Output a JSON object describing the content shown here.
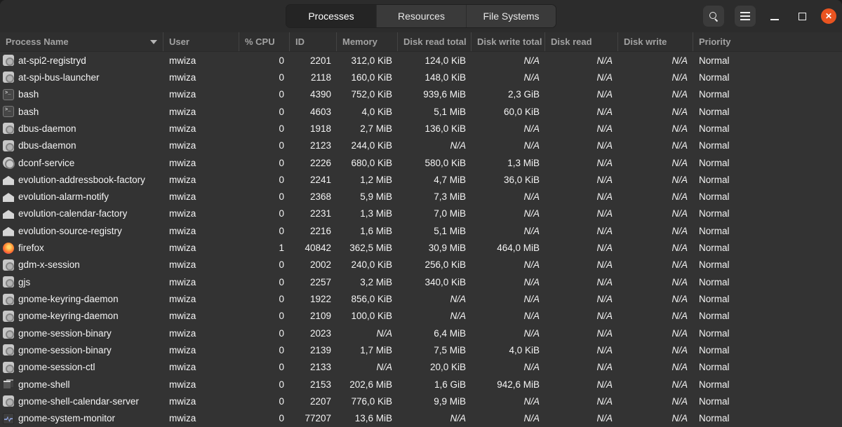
{
  "header": {
    "tabs": [
      {
        "label": "Processes",
        "active": true
      },
      {
        "label": "Resources",
        "active": false
      },
      {
        "label": "File Systems",
        "active": false
      }
    ],
    "close_label": "✕"
  },
  "colors": {
    "close_button": "#e95420",
    "headerbar": "#2c2c2c",
    "table_background": "#333333"
  },
  "table": {
    "columns": [
      {
        "key": "name",
        "label": "Process Name",
        "sorted": "desc"
      },
      {
        "key": "user",
        "label": "User"
      },
      {
        "key": "cpu",
        "label": "% CPU"
      },
      {
        "key": "id",
        "label": "ID"
      },
      {
        "key": "memory",
        "label": "Memory"
      },
      {
        "key": "disk_read_total",
        "label": "Disk read total"
      },
      {
        "key": "disk_write_total",
        "label": "Disk write total"
      },
      {
        "key": "disk_read",
        "label": "Disk read"
      },
      {
        "key": "disk_write",
        "label": "Disk write"
      },
      {
        "key": "priority",
        "label": "Priority"
      }
    ],
    "rows": [
      {
        "name": "at-spi2-registryd",
        "icon": "application",
        "user": "mwiza",
        "cpu": "0",
        "id": "2201",
        "memory": "312,0 KiB",
        "disk_read_total": "124,0 KiB",
        "disk_write_total": "N/A",
        "disk_read": "N/A",
        "disk_write": "N/A",
        "priority": "Normal"
      },
      {
        "name": "at-spi-bus-launcher",
        "icon": "application",
        "user": "mwiza",
        "cpu": "0",
        "id": "2118",
        "memory": "160,0 KiB",
        "disk_read_total": "148,0 KiB",
        "disk_write_total": "N/A",
        "disk_read": "N/A",
        "disk_write": "N/A",
        "priority": "Normal"
      },
      {
        "name": "bash",
        "icon": "terminal",
        "user": "mwiza",
        "cpu": "0",
        "id": "4390",
        "memory": "752,0 KiB",
        "disk_read_total": "939,6 MiB",
        "disk_write_total": "2,3 GiB",
        "disk_read": "N/A",
        "disk_write": "N/A",
        "priority": "Normal"
      },
      {
        "name": "bash",
        "icon": "terminal",
        "user": "mwiza",
        "cpu": "0",
        "id": "4603",
        "memory": "4,0 KiB",
        "disk_read_total": "5,1 MiB",
        "disk_write_total": "60,0 KiB",
        "disk_read": "N/A",
        "disk_write": "N/A",
        "priority": "Normal"
      },
      {
        "name": "dbus-daemon",
        "icon": "application",
        "user": "mwiza",
        "cpu": "0",
        "id": "1918",
        "memory": "2,7 MiB",
        "disk_read_total": "136,0 KiB",
        "disk_write_total": "N/A",
        "disk_read": "N/A",
        "disk_write": "N/A",
        "priority": "Normal"
      },
      {
        "name": "dbus-daemon",
        "icon": "application",
        "user": "mwiza",
        "cpu": "0",
        "id": "2123",
        "memory": "244,0 KiB",
        "disk_read_total": "N/A",
        "disk_write_total": "N/A",
        "disk_read": "N/A",
        "disk_write": "N/A",
        "priority": "Normal"
      },
      {
        "name": "dconf-service",
        "icon": "rings",
        "user": "mwiza",
        "cpu": "0",
        "id": "2226",
        "memory": "680,0 KiB",
        "disk_read_total": "580,0 KiB",
        "disk_write_total": "1,3 MiB",
        "disk_read": "N/A",
        "disk_write": "N/A",
        "priority": "Normal"
      },
      {
        "name": "evolution-addressbook-factory",
        "icon": "envelope",
        "user": "mwiza",
        "cpu": "0",
        "id": "2241",
        "memory": "1,2 MiB",
        "disk_read_total": "4,7 MiB",
        "disk_write_total": "36,0 KiB",
        "disk_read": "N/A",
        "disk_write": "N/A",
        "priority": "Normal"
      },
      {
        "name": "evolution-alarm-notify",
        "icon": "envelope",
        "user": "mwiza",
        "cpu": "0",
        "id": "2368",
        "memory": "5,9 MiB",
        "disk_read_total": "7,3 MiB",
        "disk_write_total": "N/A",
        "disk_read": "N/A",
        "disk_write": "N/A",
        "priority": "Normal"
      },
      {
        "name": "evolution-calendar-factory",
        "icon": "envelope",
        "user": "mwiza",
        "cpu": "0",
        "id": "2231",
        "memory": "1,3 MiB",
        "disk_read_total": "7,0 MiB",
        "disk_write_total": "N/A",
        "disk_read": "N/A",
        "disk_write": "N/A",
        "priority": "Normal"
      },
      {
        "name": "evolution-source-registry",
        "icon": "envelope",
        "user": "mwiza",
        "cpu": "0",
        "id": "2216",
        "memory": "1,6 MiB",
        "disk_read_total": "5,1 MiB",
        "disk_write_total": "N/A",
        "disk_read": "N/A",
        "disk_write": "N/A",
        "priority": "Normal"
      },
      {
        "name": "firefox",
        "icon": "firefox",
        "user": "mwiza",
        "cpu": "1",
        "id": "40842",
        "memory": "362,5 MiB",
        "disk_read_total": "30,9 MiB",
        "disk_write_total": "464,0 MiB",
        "disk_read": "N/A",
        "disk_write": "N/A",
        "priority": "Normal"
      },
      {
        "name": "gdm-x-session",
        "icon": "application",
        "user": "mwiza",
        "cpu": "0",
        "id": "2002",
        "memory": "240,0 KiB",
        "disk_read_total": "256,0 KiB",
        "disk_write_total": "N/A",
        "disk_read": "N/A",
        "disk_write": "N/A",
        "priority": "Normal"
      },
      {
        "name": "gjs",
        "icon": "application",
        "user": "mwiza",
        "cpu": "0",
        "id": "2257",
        "memory": "3,2 MiB",
        "disk_read_total": "340,0 KiB",
        "disk_write_total": "N/A",
        "disk_read": "N/A",
        "disk_write": "N/A",
        "priority": "Normal"
      },
      {
        "name": "gnome-keyring-daemon",
        "icon": "application",
        "user": "mwiza",
        "cpu": "0",
        "id": "1922",
        "memory": "856,0 KiB",
        "disk_read_total": "N/A",
        "disk_write_total": "N/A",
        "disk_read": "N/A",
        "disk_write": "N/A",
        "priority": "Normal"
      },
      {
        "name": "gnome-keyring-daemon",
        "icon": "application",
        "user": "mwiza",
        "cpu": "0",
        "id": "2109",
        "memory": "100,0 KiB",
        "disk_read_total": "N/A",
        "disk_write_total": "N/A",
        "disk_read": "N/A",
        "disk_write": "N/A",
        "priority": "Normal"
      },
      {
        "name": "gnome-session-binary",
        "icon": "application",
        "user": "mwiza",
        "cpu": "0",
        "id": "2023",
        "memory": "N/A",
        "disk_read_total": "6,4 MiB",
        "disk_write_total": "N/A",
        "disk_read": "N/A",
        "disk_write": "N/A",
        "priority": "Normal"
      },
      {
        "name": "gnome-session-binary",
        "icon": "application",
        "user": "mwiza",
        "cpu": "0",
        "id": "2139",
        "memory": "1,7 MiB",
        "disk_read_total": "7,5 MiB",
        "disk_write_total": "4,0 KiB",
        "disk_read": "N/A",
        "disk_write": "N/A",
        "priority": "Normal"
      },
      {
        "name": "gnome-session-ctl",
        "icon": "application",
        "user": "mwiza",
        "cpu": "0",
        "id": "2133",
        "memory": "N/A",
        "disk_read_total": "20,0 KiB",
        "disk_write_total": "N/A",
        "disk_read": "N/A",
        "disk_write": "N/A",
        "priority": "Normal"
      },
      {
        "name": "gnome-shell",
        "icon": "windows",
        "user": "mwiza",
        "cpu": "0",
        "id": "2153",
        "memory": "202,6 MiB",
        "disk_read_total": "1,6 GiB",
        "disk_write_total": "942,6 MiB",
        "disk_read": "N/A",
        "disk_write": "N/A",
        "priority": "Normal"
      },
      {
        "name": "gnome-shell-calendar-server",
        "icon": "application",
        "user": "mwiza",
        "cpu": "0",
        "id": "2207",
        "memory": "776,0 KiB",
        "disk_read_total": "9,9 MiB",
        "disk_write_total": "N/A",
        "disk_read": "N/A",
        "disk_write": "N/A",
        "priority": "Normal"
      },
      {
        "name": "gnome-system-monitor",
        "icon": "monitor",
        "user": "mwiza",
        "cpu": "0",
        "id": "77207",
        "memory": "13,6 MiB",
        "disk_read_total": "N/A",
        "disk_write_total": "N/A",
        "disk_read": "N/A",
        "disk_write": "N/A",
        "priority": "Normal"
      }
    ]
  }
}
